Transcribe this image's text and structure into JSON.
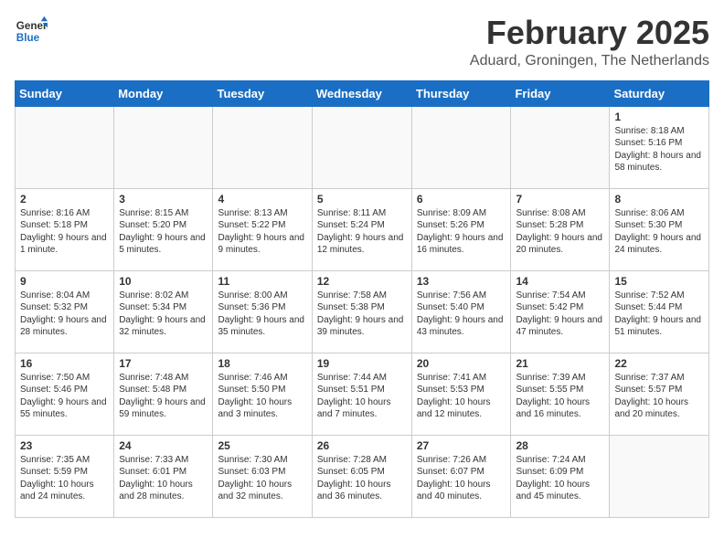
{
  "logo": {
    "line1": "General",
    "line2": "Blue"
  },
  "title": "February 2025",
  "subtitle": "Aduard, Groningen, The Netherlands",
  "weekdays": [
    "Sunday",
    "Monday",
    "Tuesday",
    "Wednesday",
    "Thursday",
    "Friday",
    "Saturday"
  ],
  "weeks": [
    [
      {
        "day": "",
        "info": ""
      },
      {
        "day": "",
        "info": ""
      },
      {
        "day": "",
        "info": ""
      },
      {
        "day": "",
        "info": ""
      },
      {
        "day": "",
        "info": ""
      },
      {
        "day": "",
        "info": ""
      },
      {
        "day": "1",
        "info": "Sunrise: 8:18 AM\nSunset: 5:16 PM\nDaylight: 8 hours and 58 minutes."
      }
    ],
    [
      {
        "day": "2",
        "info": "Sunrise: 8:16 AM\nSunset: 5:18 PM\nDaylight: 9 hours and 1 minute."
      },
      {
        "day": "3",
        "info": "Sunrise: 8:15 AM\nSunset: 5:20 PM\nDaylight: 9 hours and 5 minutes."
      },
      {
        "day": "4",
        "info": "Sunrise: 8:13 AM\nSunset: 5:22 PM\nDaylight: 9 hours and 9 minutes."
      },
      {
        "day": "5",
        "info": "Sunrise: 8:11 AM\nSunset: 5:24 PM\nDaylight: 9 hours and 12 minutes."
      },
      {
        "day": "6",
        "info": "Sunrise: 8:09 AM\nSunset: 5:26 PM\nDaylight: 9 hours and 16 minutes."
      },
      {
        "day": "7",
        "info": "Sunrise: 8:08 AM\nSunset: 5:28 PM\nDaylight: 9 hours and 20 minutes."
      },
      {
        "day": "8",
        "info": "Sunrise: 8:06 AM\nSunset: 5:30 PM\nDaylight: 9 hours and 24 minutes."
      }
    ],
    [
      {
        "day": "9",
        "info": "Sunrise: 8:04 AM\nSunset: 5:32 PM\nDaylight: 9 hours and 28 minutes."
      },
      {
        "day": "10",
        "info": "Sunrise: 8:02 AM\nSunset: 5:34 PM\nDaylight: 9 hours and 32 minutes."
      },
      {
        "day": "11",
        "info": "Sunrise: 8:00 AM\nSunset: 5:36 PM\nDaylight: 9 hours and 35 minutes."
      },
      {
        "day": "12",
        "info": "Sunrise: 7:58 AM\nSunset: 5:38 PM\nDaylight: 9 hours and 39 minutes."
      },
      {
        "day": "13",
        "info": "Sunrise: 7:56 AM\nSunset: 5:40 PM\nDaylight: 9 hours and 43 minutes."
      },
      {
        "day": "14",
        "info": "Sunrise: 7:54 AM\nSunset: 5:42 PM\nDaylight: 9 hours and 47 minutes."
      },
      {
        "day": "15",
        "info": "Sunrise: 7:52 AM\nSunset: 5:44 PM\nDaylight: 9 hours and 51 minutes."
      }
    ],
    [
      {
        "day": "16",
        "info": "Sunrise: 7:50 AM\nSunset: 5:46 PM\nDaylight: 9 hours and 55 minutes."
      },
      {
        "day": "17",
        "info": "Sunrise: 7:48 AM\nSunset: 5:48 PM\nDaylight: 9 hours and 59 minutes."
      },
      {
        "day": "18",
        "info": "Sunrise: 7:46 AM\nSunset: 5:50 PM\nDaylight: 10 hours and 3 minutes."
      },
      {
        "day": "19",
        "info": "Sunrise: 7:44 AM\nSunset: 5:51 PM\nDaylight: 10 hours and 7 minutes."
      },
      {
        "day": "20",
        "info": "Sunrise: 7:41 AM\nSunset: 5:53 PM\nDaylight: 10 hours and 12 minutes."
      },
      {
        "day": "21",
        "info": "Sunrise: 7:39 AM\nSunset: 5:55 PM\nDaylight: 10 hours and 16 minutes."
      },
      {
        "day": "22",
        "info": "Sunrise: 7:37 AM\nSunset: 5:57 PM\nDaylight: 10 hours and 20 minutes."
      }
    ],
    [
      {
        "day": "23",
        "info": "Sunrise: 7:35 AM\nSunset: 5:59 PM\nDaylight: 10 hours and 24 minutes."
      },
      {
        "day": "24",
        "info": "Sunrise: 7:33 AM\nSunset: 6:01 PM\nDaylight: 10 hours and 28 minutes."
      },
      {
        "day": "25",
        "info": "Sunrise: 7:30 AM\nSunset: 6:03 PM\nDaylight: 10 hours and 32 minutes."
      },
      {
        "day": "26",
        "info": "Sunrise: 7:28 AM\nSunset: 6:05 PM\nDaylight: 10 hours and 36 minutes."
      },
      {
        "day": "27",
        "info": "Sunrise: 7:26 AM\nSunset: 6:07 PM\nDaylight: 10 hours and 40 minutes."
      },
      {
        "day": "28",
        "info": "Sunrise: 7:24 AM\nSunset: 6:09 PM\nDaylight: 10 hours and 45 minutes."
      },
      {
        "day": "",
        "info": ""
      }
    ]
  ]
}
